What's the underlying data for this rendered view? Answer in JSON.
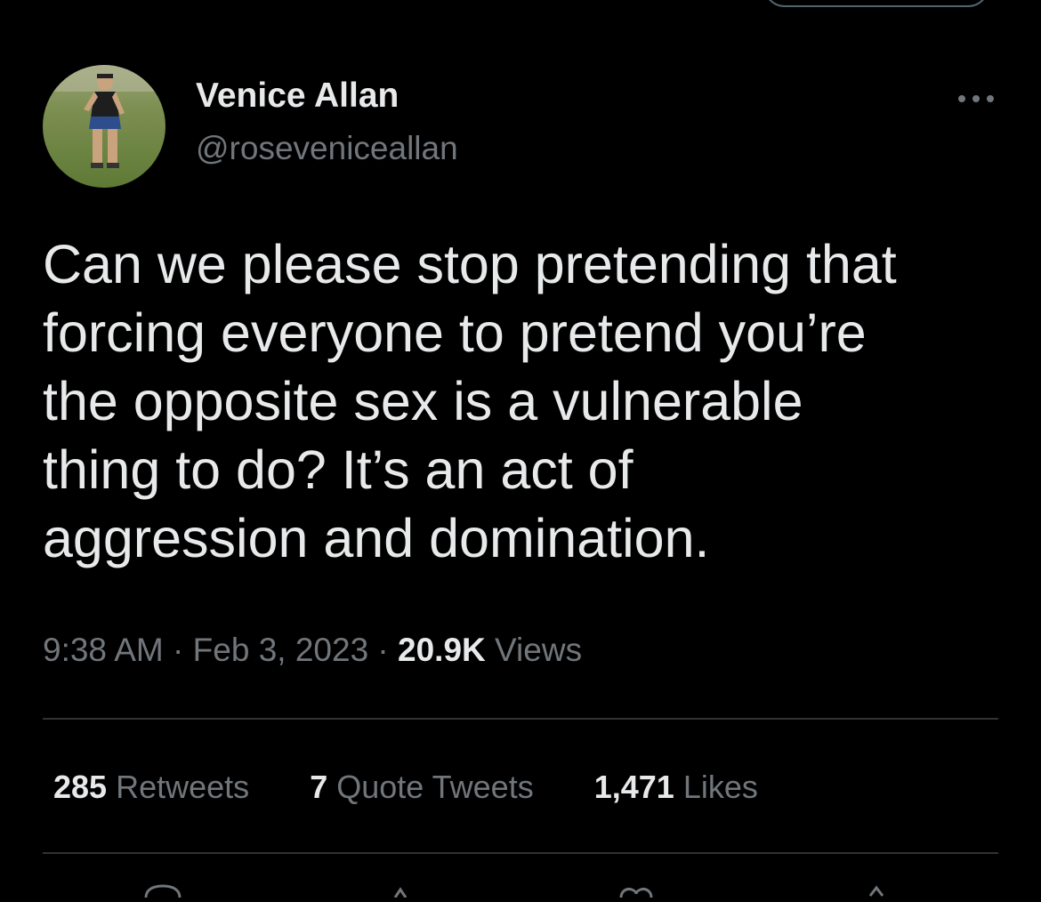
{
  "tweet": {
    "author": {
      "display_name": "Venice Allan",
      "handle": "@roseveniceallan",
      "avatar_icon": "profile-photo"
    },
    "more_icon": "more-horizontal-icon",
    "text_lines": [
      "Can we please stop pretending that",
      "forcing everyone to pretend you’re",
      "the opposite sex is a vulnerable",
      "thing to do? It’s an act of",
      "aggression and domination."
    ],
    "time": "9:38 AM",
    "separator": "·",
    "date": "Feb 3, 2023",
    "views_count": "20.9K",
    "views_label": "Views",
    "stats": {
      "retweets_count": "285",
      "retweets_label": "Retweets",
      "quotes_count": "7",
      "quotes_label": "Quote Tweets",
      "likes_count": "1,471",
      "likes_label": "Likes"
    },
    "actions": [
      "reply-icon",
      "retweet-icon",
      "like-icon",
      "share-icon"
    ]
  },
  "colors": {
    "background": "#000000",
    "primary_text": "#e7e9ea",
    "secondary_text": "#71767b",
    "divider": "#2f3336"
  }
}
